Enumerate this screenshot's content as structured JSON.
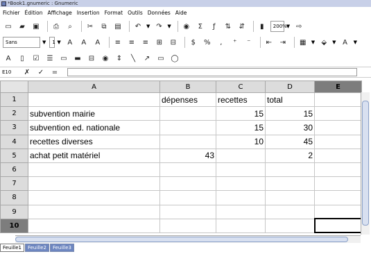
{
  "window": {
    "title": "*Book1.gnumeric : Gnumeric"
  },
  "menu": [
    "Fichier",
    "Édition",
    "Affichage",
    "Insertion",
    "Format",
    "Outils",
    "Données",
    "Aide"
  ],
  "toolbar": {
    "zoom": "200%"
  },
  "format_bar": {
    "font": "Sans",
    "size": "1"
  },
  "edit_bar": {
    "cell_ref": "E10"
  },
  "columns": [
    "A",
    "B",
    "C",
    "D",
    "E"
  ],
  "selected_column": "E",
  "selected_row": "10",
  "rows": [
    {
      "num": "1",
      "cells": [
        "",
        "dépenses",
        "recettes",
        "total",
        ""
      ]
    },
    {
      "num": "2",
      "cells": [
        "subvention mairie",
        "",
        "15",
        "15",
        ""
      ]
    },
    {
      "num": "3",
      "cells": [
        "subvention ed. nationale",
        "",
        "15",
        "30",
        ""
      ]
    },
    {
      "num": "4",
      "cells": [
        "recettes diverses",
        "",
        "10",
        "45",
        ""
      ]
    },
    {
      "num": "5",
      "cells": [
        "achat petit matériel",
        "43",
        "",
        "2",
        ""
      ]
    },
    {
      "num": "6",
      "cells": [
        "",
        "",
        "",
        "",
        ""
      ]
    },
    {
      "num": "7",
      "cells": [
        "",
        "",
        "",
        "",
        ""
      ]
    },
    {
      "num": "8",
      "cells": [
        "",
        "",
        "",
        "",
        ""
      ]
    },
    {
      "num": "9",
      "cells": [
        "",
        "",
        "",
        "",
        ""
      ]
    },
    {
      "num": "10",
      "cells": [
        "",
        "",
        "",
        "",
        ""
      ]
    }
  ],
  "sheets": [
    "Feuille1",
    "Feuille2",
    "Feuille3"
  ],
  "active_sheet": 0
}
